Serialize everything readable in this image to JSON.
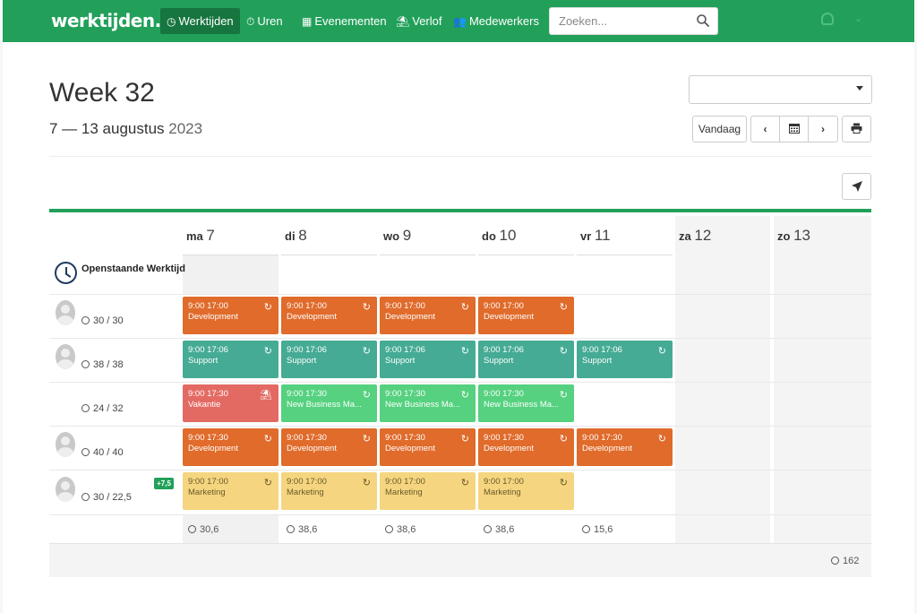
{
  "nav": {
    "brand": "werktijden.nl",
    "items": [
      {
        "label": "Werktijden",
        "icon": "clock-icon",
        "active": true
      },
      {
        "label": "Uren",
        "icon": "stopwatch-icon"
      },
      {
        "label": "Evenementen",
        "icon": "calendar-icon"
      },
      {
        "label": "Verlof",
        "icon": "beach-umbrella-icon"
      },
      {
        "label": "Medewerkers",
        "icon": "users-icon"
      }
    ],
    "search_placeholder": "Zoeken..."
  },
  "header": {
    "title": "Week 32",
    "range": "7 — 13 augustus",
    "year": "2023",
    "today_label": "Vandaag"
  },
  "days": [
    {
      "abbr": "ma",
      "num": "7"
    },
    {
      "abbr": "di",
      "num": "8"
    },
    {
      "abbr": "wo",
      "num": "9"
    },
    {
      "abbr": "do",
      "num": "10"
    },
    {
      "abbr": "vr",
      "num": "11"
    },
    {
      "abbr": "za",
      "num": "12"
    },
    {
      "abbr": "zo",
      "num": "13"
    }
  ],
  "open_row_label": "Openstaande Werktijd",
  "employees": [
    {
      "hours": "30 / 30",
      "avatar": true,
      "shifts": [
        {
          "day": 0,
          "time": "9:00 17:00",
          "name": "Development",
          "color": "orange",
          "icon": "repeat"
        },
        {
          "day": 1,
          "time": "9:00 17:00",
          "name": "Development",
          "color": "orange",
          "icon": "repeat"
        },
        {
          "day": 2,
          "time": "9:00 17:00",
          "name": "Development",
          "color": "orange",
          "icon": "repeat"
        },
        {
          "day": 3,
          "time": "9:00 17:00",
          "name": "Development",
          "color": "orange",
          "icon": "repeat"
        }
      ]
    },
    {
      "hours": "38 / 38",
      "avatar": true,
      "shifts": [
        {
          "day": 0,
          "time": "9:00 17:06",
          "name": "Support",
          "color": "teal",
          "icon": "repeat"
        },
        {
          "day": 1,
          "time": "9:00 17:06",
          "name": "Support",
          "color": "teal",
          "icon": "repeat"
        },
        {
          "day": 2,
          "time": "9:00 17:06",
          "name": "Support",
          "color": "teal",
          "icon": "repeat"
        },
        {
          "day": 3,
          "time": "9:00 17:06",
          "name": "Support",
          "color": "teal",
          "icon": "repeat"
        },
        {
          "day": 4,
          "time": "9:00 17:06",
          "name": "Support",
          "color": "teal",
          "icon": "repeat"
        }
      ]
    },
    {
      "hours": "24 / 32",
      "avatar": false,
      "shifts": [
        {
          "day": 0,
          "time": "9:00 17:30",
          "name": "Vakantie",
          "color": "red",
          "icon": "umbrella"
        },
        {
          "day": 1,
          "time": "9:00 17:30",
          "name": "New Business Ma...",
          "color": "green",
          "icon": "repeat"
        },
        {
          "day": 2,
          "time": "9:00 17:30",
          "name": "New Business Ma...",
          "color": "green",
          "icon": "repeat"
        },
        {
          "day": 3,
          "time": "9:00 17:30",
          "name": "New Business Ma...",
          "color": "green",
          "icon": "repeat"
        }
      ]
    },
    {
      "hours": "40 / 40",
      "avatar": true,
      "shifts": [
        {
          "day": 0,
          "time": "9:00 17:30",
          "name": "Development",
          "color": "orange",
          "icon": "repeat"
        },
        {
          "day": 1,
          "time": "9:00 17:30",
          "name": "Development",
          "color": "orange",
          "icon": "repeat"
        },
        {
          "day": 2,
          "time": "9:00 17:30",
          "name": "Development",
          "color": "orange",
          "icon": "repeat"
        },
        {
          "day": 3,
          "time": "9:00 17:30",
          "name": "Development",
          "color": "orange",
          "icon": "repeat"
        },
        {
          "day": 4,
          "time": "9:00 17:30",
          "name": "Development",
          "color": "orange",
          "icon": "repeat"
        }
      ]
    },
    {
      "hours": "30 / 22,5",
      "avatar": true,
      "badge": "+7,5",
      "shifts": [
        {
          "day": 0,
          "time": "9:00 17:00",
          "name": "Marketing",
          "color": "yellow",
          "icon": "repeat"
        },
        {
          "day": 1,
          "time": "9:00 17:00",
          "name": "Marketing",
          "color": "yellow",
          "icon": "repeat"
        },
        {
          "day": 2,
          "time": "9:00 17:00",
          "name": "Marketing",
          "color": "yellow",
          "icon": "repeat"
        },
        {
          "day": 3,
          "time": "9:00 17:00",
          "name": "Marketing",
          "color": "yellow",
          "icon": "repeat"
        }
      ]
    }
  ],
  "day_totals": [
    "30,6",
    "38,6",
    "38,6",
    "38,6",
    "15,6"
  ],
  "grand_total": "162",
  "colors": {
    "brand": "#22a05a",
    "orange": "#e06b2b",
    "teal": "#45ab94",
    "red": "#e36a63",
    "green": "#55d17f",
    "yellow": "#f5d57f"
  }
}
